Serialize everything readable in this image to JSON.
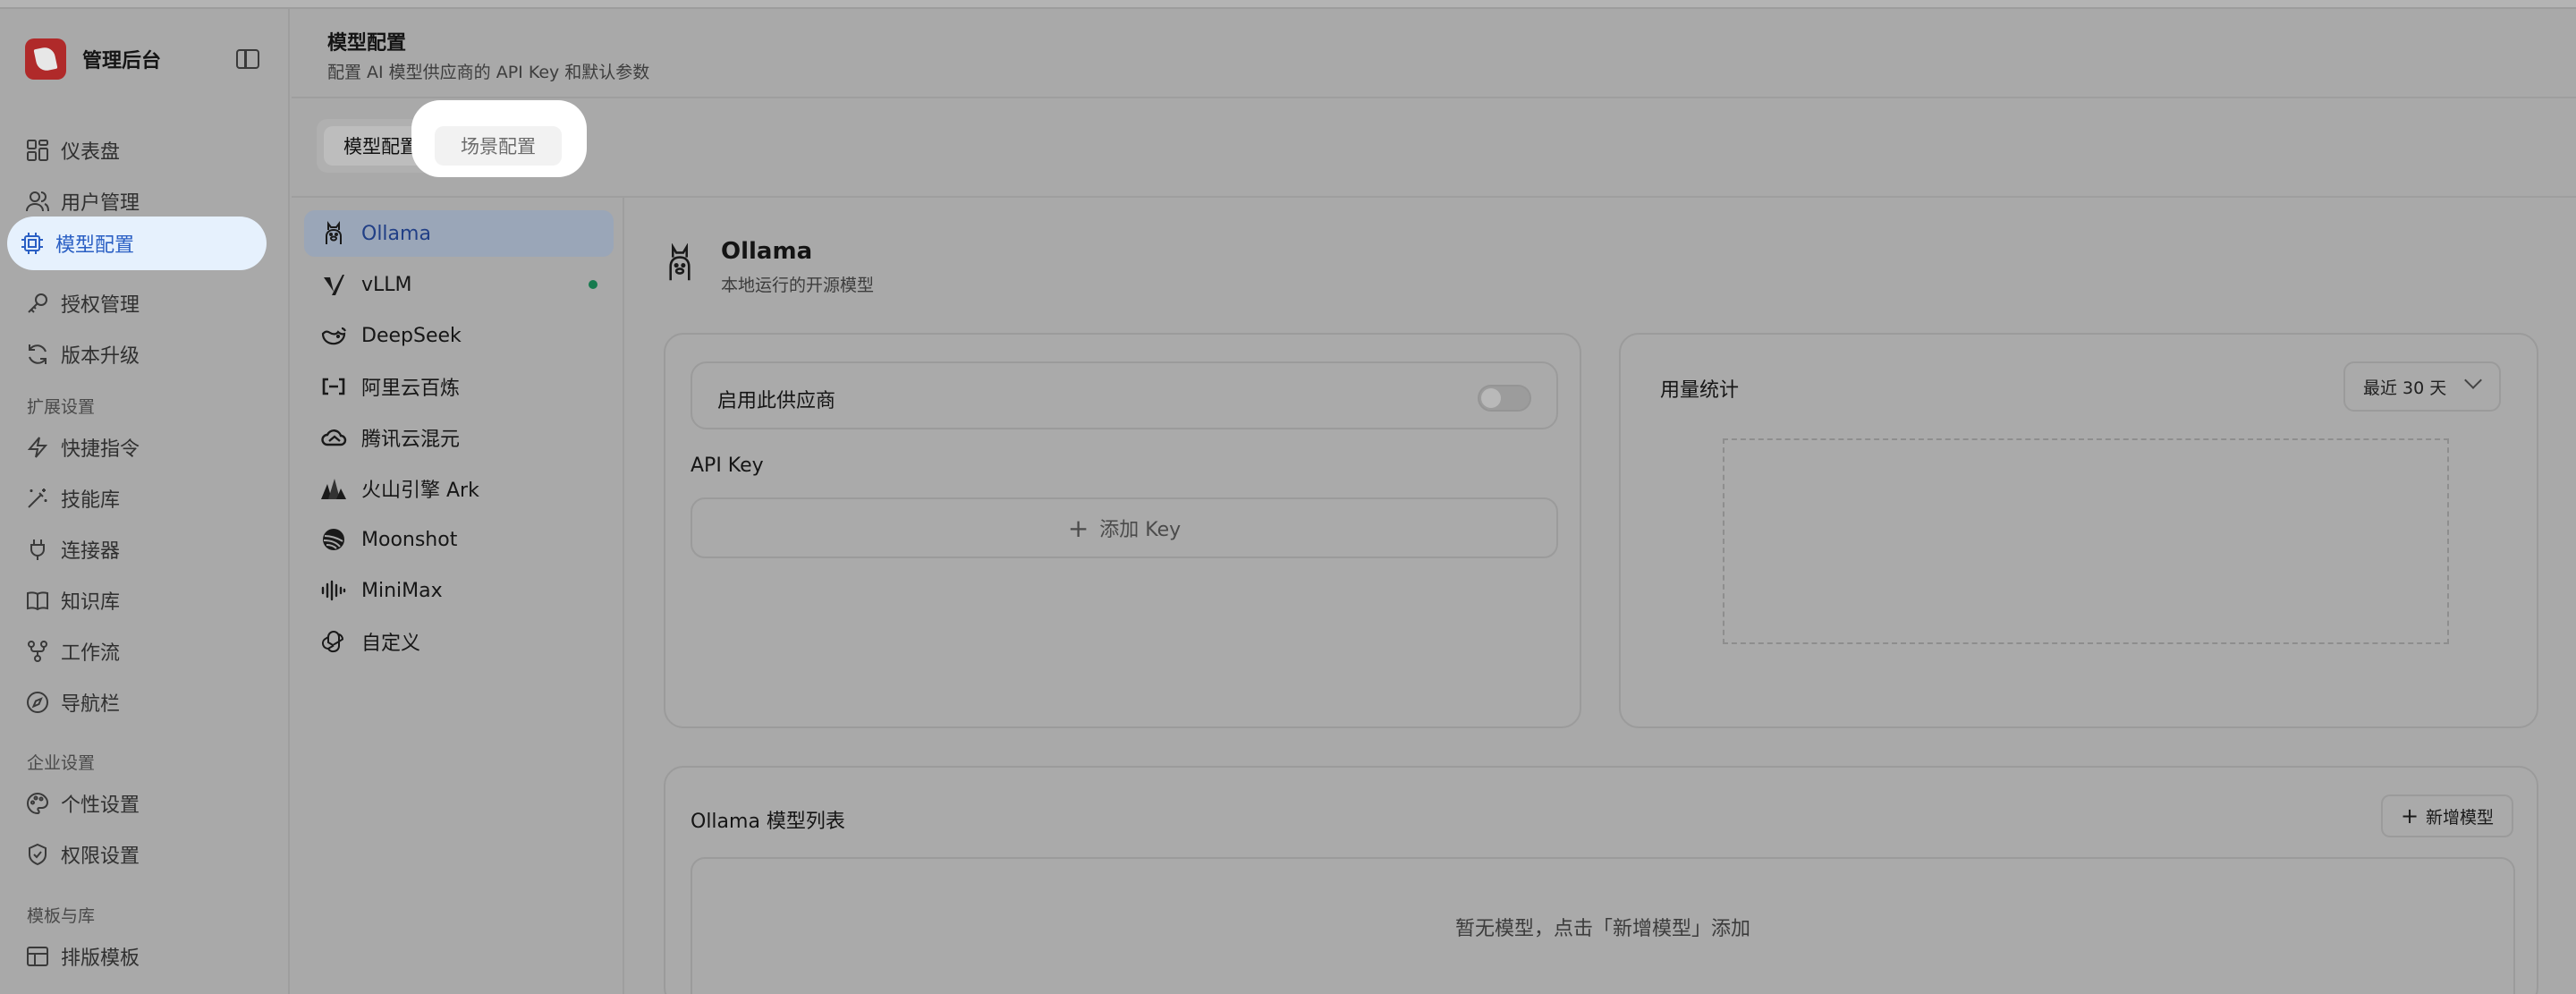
{
  "app": {
    "name": "管理后台"
  },
  "sidebar": {
    "items_top": [
      {
        "label": "仪表盘",
        "icon": "dashboard-icon"
      },
      {
        "label": "用户管理",
        "icon": "users-icon"
      },
      {
        "label": "模型配置",
        "icon": "chip-icon",
        "active": true
      },
      {
        "label": "授权管理",
        "icon": "key-icon"
      },
      {
        "label": "版本升级",
        "icon": "refresh-icon"
      }
    ],
    "section_ext": "扩展设置",
    "items_ext": [
      {
        "label": "快捷指令",
        "icon": "lightning-icon"
      },
      {
        "label": "技能库",
        "icon": "magic-wand-icon"
      },
      {
        "label": "连接器",
        "icon": "plug-icon"
      },
      {
        "label": "知识库",
        "icon": "book-icon"
      },
      {
        "label": "工作流",
        "icon": "workflow-icon"
      },
      {
        "label": "导航栏",
        "icon": "compass-icon"
      }
    ],
    "section_ent": "企业设置",
    "items_ent": [
      {
        "label": "个性设置",
        "icon": "palette-icon"
      },
      {
        "label": "权限设置",
        "icon": "shield-icon"
      }
    ],
    "section_tpl": "模板与库",
    "items_tpl": [
      {
        "label": "排版模板",
        "icon": "layout-icon"
      }
    ]
  },
  "header": {
    "title": "模型配置",
    "subtitle": "配置 AI 模型供应商的 API Key 和默认参数"
  },
  "tabs": [
    {
      "label": "模型配置",
      "active": true
    },
    {
      "label": "场景配置",
      "active": false
    }
  ],
  "providers": [
    {
      "name": "Ollama",
      "icon": "llama-icon",
      "active": true
    },
    {
      "name": "vLLM",
      "icon": "vllm-icon",
      "status": "online"
    },
    {
      "name": "DeepSeek",
      "icon": "whale-icon"
    },
    {
      "name": "阿里云百炼",
      "icon": "bracket-icon"
    },
    {
      "name": "腾讯云混元",
      "icon": "cloud-icon"
    },
    {
      "name": "火山引擎 Ark",
      "icon": "mountain-icon"
    },
    {
      "name": "Moonshot",
      "icon": "moon-icon"
    },
    {
      "name": "MiniMax",
      "icon": "waveform-icon"
    },
    {
      "name": "自定义",
      "icon": "openai-icon"
    }
  ],
  "detail": {
    "name": "Ollama",
    "description": "本地运行的开源模型",
    "enable_label": "启用此供应商",
    "enabled": false,
    "api_key_label": "API Key",
    "add_key_label": "添加 Key",
    "usage_title": "用量统计",
    "range_value": "最近 30 天",
    "model_list_title": "Ollama 模型列表",
    "new_model_label": "新增模型",
    "empty_text": "暂无模型，点击「新增模型」添加"
  },
  "colors": {
    "active_blue": "#2a5fc4",
    "status_green": "#167a4e",
    "brand_red": "#b02a2a"
  }
}
